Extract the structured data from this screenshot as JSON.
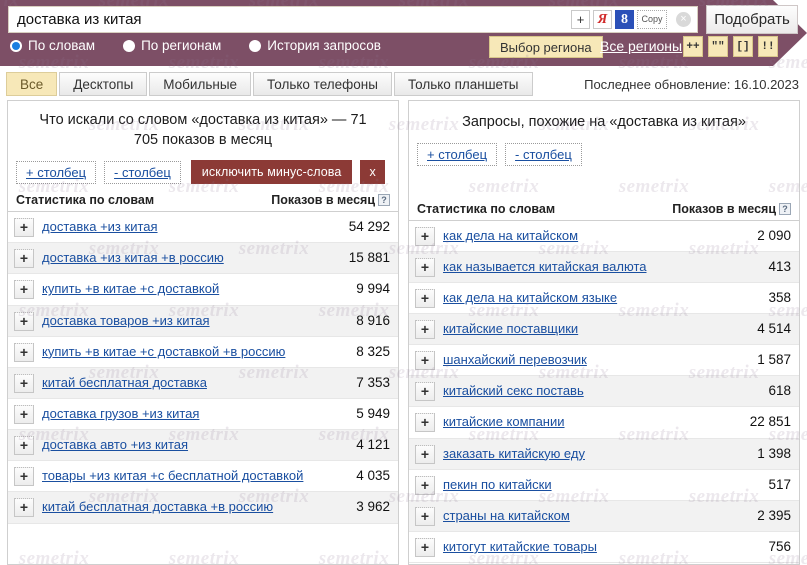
{
  "search": {
    "value": "доставка из китая",
    "placeholder": "доставка из китая",
    "plus_label": "+",
    "yandex_label": "Я",
    "google_label": "8",
    "copy_label": "Copy",
    "clear_label": "×"
  },
  "header": {
    "pick_button": "Подобрать",
    "region_button": "Выбор региона",
    "region_all": "Все регионы",
    "mini_buttons": [
      "++",
      "\"\"",
      "[]",
      "!!"
    ],
    "modes": [
      {
        "label": "По словам",
        "selected": true
      },
      {
        "label": "По регионам",
        "selected": false
      },
      {
        "label": "История запросов",
        "selected": false
      }
    ],
    "accent_color": "#7d4f66",
    "highlight_color": "#f7e8b8"
  },
  "tabbar": {
    "tabs": [
      {
        "label": "Все",
        "active": true
      },
      {
        "label": "Десктопы",
        "active": false
      },
      {
        "label": "Мобильные",
        "active": false
      },
      {
        "label": "Только телефоны",
        "active": false
      },
      {
        "label": "Только планшеты",
        "active": false
      }
    ],
    "last_update": "Последнее обновление: 16.10.2023"
  },
  "left_panel": {
    "title": "Что искали со словом «доставка из китая» — 71 705 показов в месяц",
    "add_column": "+ столбец",
    "remove_column": "- столбец",
    "exclude_button": "исключить минус-слова",
    "close_button": "x",
    "col_keyword": "Статистика по словам",
    "col_shows": "Показов в месяц",
    "help": "?",
    "rows": [
      {
        "keyword": "доставка +из китая",
        "shows": "54 292"
      },
      {
        "keyword": "доставка +из китая +в россию",
        "shows": "15 881"
      },
      {
        "keyword": "купить +в китае +с доставкой",
        "shows": "9 994"
      },
      {
        "keyword": "доставка товаров +из китая",
        "shows": "8 916"
      },
      {
        "keyword": "купить +в китае +с доставкой +в россию",
        "shows": "8 325"
      },
      {
        "keyword": "китай бесплатная доставка",
        "shows": "7 353"
      },
      {
        "keyword": "доставка грузов +из китая",
        "shows": "5 949"
      },
      {
        "keyword": "доставка авто +из китая",
        "shows": "4 121"
      },
      {
        "keyword": "товары +из китая +с бесплатной доставкой",
        "shows": "4 035"
      },
      {
        "keyword": "китай бесплатная доставка +в россию",
        "shows": "3 962"
      }
    ]
  },
  "right_panel": {
    "title": "Запросы, похожие на «доставка из китая»",
    "add_column": "+ столбец",
    "remove_column": "- столбец",
    "col_keyword": "Статистика по словам",
    "col_shows": "Показов в месяц",
    "help": "?",
    "rows": [
      {
        "keyword": "как дела на китайском",
        "shows": "2 090"
      },
      {
        "keyword": "как называется китайская валюта",
        "shows": "413"
      },
      {
        "keyword": "как дела на китайском языке",
        "shows": "358"
      },
      {
        "keyword": "китайские поставщики",
        "shows": "4 514"
      },
      {
        "keyword": "шанхайский перевозчик",
        "shows": "1 587"
      },
      {
        "keyword": "китайский секс поставь",
        "shows": "618"
      },
      {
        "keyword": "китайские компании",
        "shows": "22 851"
      },
      {
        "keyword": "заказать китайскую еду",
        "shows": "1 398"
      },
      {
        "keyword": "пекин по китайски",
        "shows": "517"
      },
      {
        "keyword": "страны на китайском",
        "shows": "2 395"
      },
      {
        "keyword": "китогут китайские товары",
        "shows": "756"
      }
    ]
  },
  "watermark": {
    "text": "semetrix"
  }
}
